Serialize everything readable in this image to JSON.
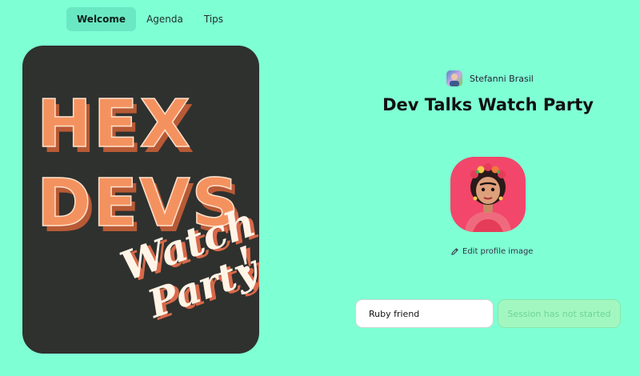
{
  "nav": {
    "tabs": [
      {
        "label": "Welcome",
        "active": true
      },
      {
        "label": "Agenda",
        "active": false
      },
      {
        "label": "Tips",
        "active": false
      }
    ]
  },
  "poster": {
    "line1": "HEX",
    "line2": "DEVS",
    "script1": "Watch",
    "script2": "Party",
    "script3": "!"
  },
  "host": {
    "name": "Stefanni Brasil",
    "avatar_icon": "avatar-icon"
  },
  "event": {
    "title": "Dev Talks Watch Party"
  },
  "profile": {
    "edit_label": "Edit profile image",
    "edit_icon": "pencil-icon"
  },
  "join": {
    "name_value": "Ruby friend",
    "status_label": "Session has not started"
  },
  "colors": {
    "background": "#7fffd4",
    "poster_bg": "#2f312e",
    "accent_orange": "#f4925f",
    "profile_bg": "#f2466a"
  }
}
